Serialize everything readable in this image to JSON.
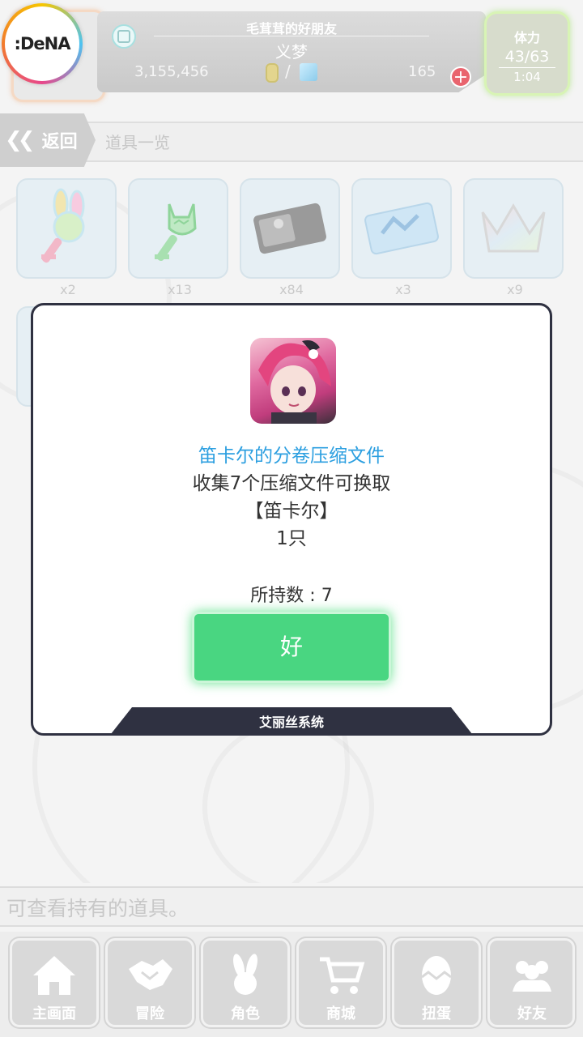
{
  "header": {
    "logo_text": ":DeNA",
    "friend_title": "毛茸茸的好朋友",
    "player_name": "义梦",
    "coins": "3,155,456",
    "slash": "/",
    "gems": "165",
    "plus_symbol": "+",
    "stamina_label": "体力",
    "stamina_value": "43/63",
    "stamina_timer": "1:04"
  },
  "breadcrumb": {
    "back_label": "返回",
    "back_chevron": "❮❮",
    "current": "道具一览"
  },
  "items": [
    {
      "icon": "bunny-key-icon",
      "count": "x2"
    },
    {
      "icon": "cat-key-icon",
      "count": "x13"
    },
    {
      "icon": "ticket-black-icon",
      "count": "x84"
    },
    {
      "icon": "ticket-blue-icon",
      "count": "x3"
    },
    {
      "icon": "crown-icon",
      "count": "x9"
    }
  ],
  "dialog": {
    "item_name": "笛卡尔的分卷压缩文件",
    "line1": "收集7个压缩文件可换取",
    "line2": "【笛卡尔】",
    "line3": "1只",
    "owned": "所持数 : 7",
    "ok_label": "好",
    "footer": "艾丽丝系统"
  },
  "info_text": "可查看持有的道具。",
  "nav": [
    {
      "label": "主画面",
      "icon": "home-icon"
    },
    {
      "label": "冒险",
      "icon": "handshake-icon"
    },
    {
      "label": "角色",
      "icon": "rabbit-icon"
    },
    {
      "label": "商城",
      "icon": "cart-icon"
    },
    {
      "label": "扭蛋",
      "icon": "egg-icon"
    },
    {
      "label": "好友",
      "icon": "friends-icon"
    }
  ],
  "colors": {
    "accent_green": "#49d681",
    "title_blue": "#2c9fe0",
    "dialog_border": "#2f3141"
  }
}
